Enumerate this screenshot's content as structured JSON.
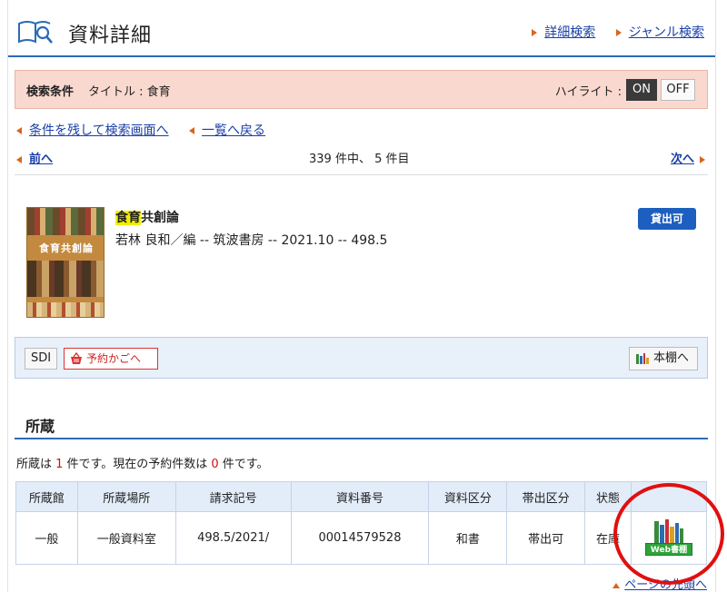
{
  "header": {
    "title": "資料詳細",
    "nav": [
      {
        "label": "詳細検索"
      },
      {
        "label": "ジャンル検索"
      }
    ]
  },
  "search_conditions": {
    "label": "検索条件",
    "value": "タイトル : 食育",
    "highlight_label": "ハイライト :",
    "on_label": "ON",
    "off_label": "OFF",
    "highlight_state": "ON"
  },
  "links": {
    "back_to_search": "条件を残して検索画面へ",
    "back_to_list": "一覧へ戻る"
  },
  "pager": {
    "prev": "前へ",
    "count": "339 件中、 5 件目",
    "next": "次へ"
  },
  "book": {
    "cover_title": "食育共創論",
    "title_highlight": "食育",
    "title_rest": "共創論",
    "meta": "若林 良和／編 -- 筑波書房 -- 2021.10 -- 498.5",
    "status_badge": "貸出可"
  },
  "actions": {
    "sdi": "SDI",
    "cart": "予約かごへ",
    "shelf": "本棚へ"
  },
  "holdings": {
    "heading": "所蔵",
    "note_prefix": "所蔵は ",
    "copies": "1",
    "note_mid": " 件です。現在の予約件数は ",
    "reservations": "0",
    "note_suffix": " 件です。",
    "columns": [
      "所蔵館",
      "所蔵場所",
      "請求記号",
      "資料番号",
      "資料区分",
      "帯出区分",
      "状態",
      ""
    ],
    "rows": [
      {
        "library": "一般",
        "location": "一般資料室",
        "call_number": "498.5/2021/",
        "item_number": "00014579528",
        "material_type": "和書",
        "loan_type": "帯出可",
        "status": "在庫",
        "web_shelf_label": "Web書棚"
      }
    ]
  },
  "page_top": "ページの先頭へ",
  "colors": {
    "accent": "#2c6bb6",
    "link": "#1a3fa8",
    "arrow": "#d9651c",
    "condition_bg": "#f9d9cf",
    "badge": "#1c5fc0",
    "annotation_circle": "#e01010"
  }
}
